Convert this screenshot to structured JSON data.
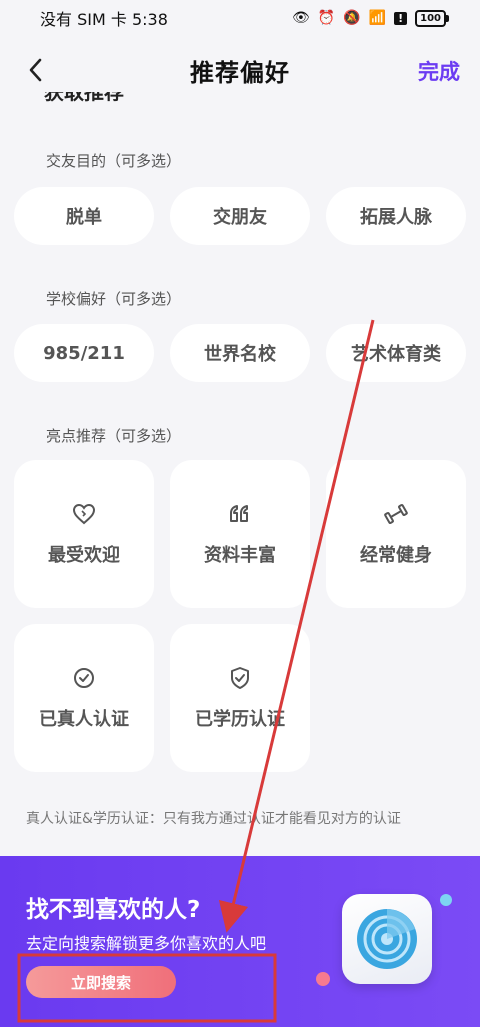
{
  "status_bar": {
    "carrier_time": "没有 SIM 卡 5:38",
    "battery": "100",
    "icons": [
      "eye-icon",
      "alarm-icon",
      "mute-icon",
      "wifi-icon",
      "alert-icon",
      "battery-icon"
    ]
  },
  "nav": {
    "title": "推荐偏好",
    "done": "完成",
    "partial_heading": "获取推荐"
  },
  "sections": [
    {
      "label": "交友目的（可多选）",
      "options": [
        "脱单",
        "交朋友",
        "拓展人脉"
      ]
    },
    {
      "label": "学校偏好（可多选）",
      "options": [
        "985/211",
        "世界名校",
        "艺术体育类"
      ]
    },
    {
      "label": "亮点推荐（可多选）",
      "cards": [
        {
          "label": "最受欢迎",
          "icon": "heart-icon"
        },
        {
          "label": "资料丰富",
          "icon": "quote-icon"
        },
        {
          "label": "经常健身",
          "icon": "dumbbell-icon"
        },
        {
          "label": "已真人认证",
          "icon": "check-circle-icon"
        },
        {
          "label": "已学历认证",
          "icon": "shield-check-icon"
        }
      ]
    }
  ],
  "note": "真人认证&学历认证：只有我方通过认证才能看见对方的认证",
  "banner": {
    "title": "找不到喜欢的人?",
    "subtitle": "去定向搜索解锁更多你喜欢的人吧",
    "button": "立即搜索"
  },
  "colors": {
    "accent": "#6c3cf2",
    "banner": "#6a3af0",
    "annotation": "#d83a3a",
    "button": "#f06f7a"
  }
}
